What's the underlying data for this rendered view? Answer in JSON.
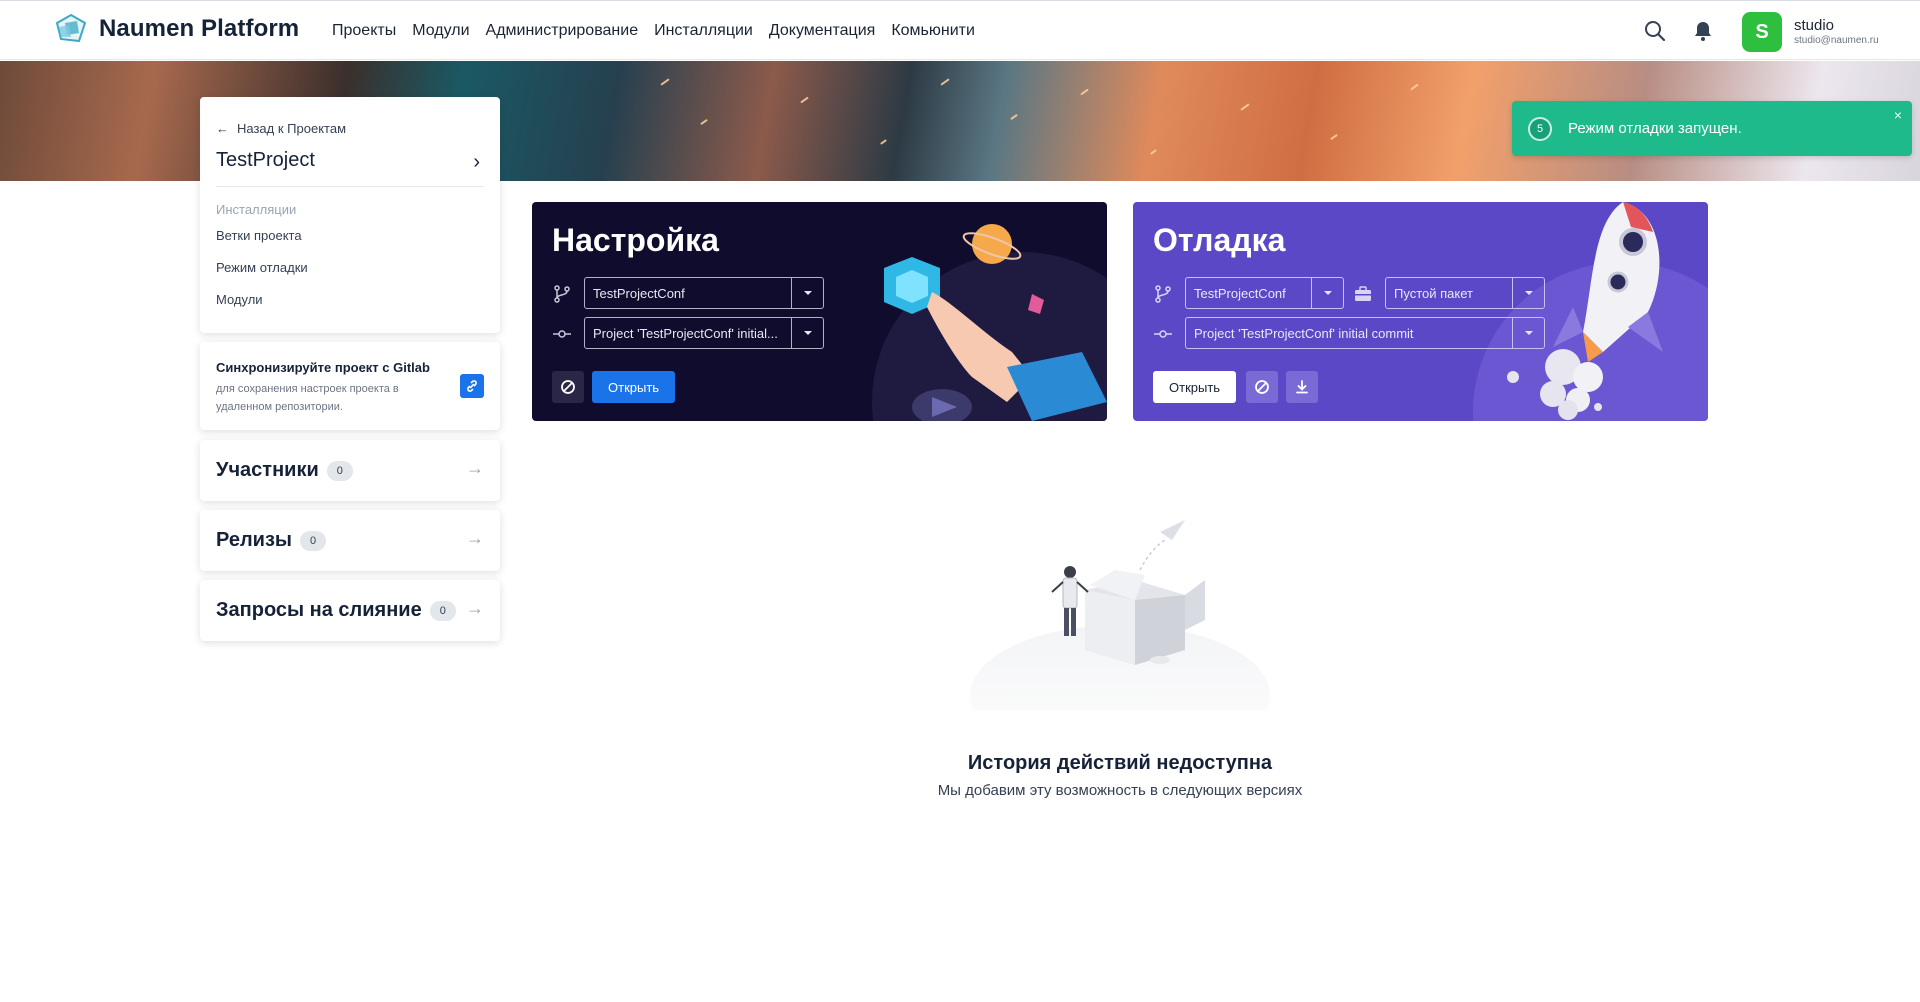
{
  "header": {
    "logo_text": "Naumen Platform",
    "nav": [
      "Проекты",
      "Модули",
      "Администрирование",
      "Инсталляции",
      "Документация",
      "Комьюнити"
    ],
    "user": {
      "initial": "S",
      "name": "studio",
      "email": "studio@naumen.ru"
    }
  },
  "sidebar": {
    "back_label": "Назад к Проектам",
    "project_name": "TestProject",
    "links": [
      {
        "label": "Инсталляции",
        "muted": true
      },
      {
        "label": "Ветки проекта"
      },
      {
        "label": "Режим отладки"
      },
      {
        "label": "Модули"
      }
    ],
    "sync": {
      "title": "Синхронизируйте проект с Gitlab",
      "desc": "для сохранения настроек проекта в удаленном репозитории."
    },
    "sections": [
      {
        "label": "Участники",
        "count": "0"
      },
      {
        "label": "Релизы",
        "count": "0"
      },
      {
        "label": "Запросы на слияние",
        "count": "0"
      }
    ]
  },
  "setup_card": {
    "title": "Настройка",
    "branch": "TestProjectConf",
    "commit": "Project 'TestProjectConf' initial...",
    "open_label": "Открыть"
  },
  "debug_card": {
    "title": "Отладка",
    "branch": "TestProjectConf",
    "package": "Пустой пакет",
    "commit": "Project 'TestProjectConf' initial commit",
    "open_label": "Открыть"
  },
  "empty_state": {
    "title": "История действий недоступна",
    "subtitle": "Мы добавим эту возможность в следующих версиях"
  },
  "toast": {
    "counter": "5",
    "text": "Режим отладки запущен.",
    "close": "×"
  },
  "colors": {
    "accent": "#1a73e8",
    "setup_bg": "#0f0c2d",
    "debug_bg": "#5b48c6",
    "toast_bg": "#1fba8c",
    "avatar_bg": "#2fbf3f"
  }
}
